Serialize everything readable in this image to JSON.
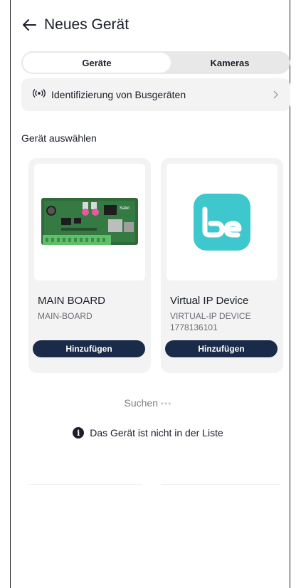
{
  "header": {
    "title": "Neues Gerät",
    "back_icon": "arrow-left-icon"
  },
  "tabs": [
    {
      "label": "Geräte",
      "active": true
    },
    {
      "label": "Kameras",
      "active": false
    }
  ],
  "bus_identification": {
    "label": "Identifizierung von Busgeräten",
    "icon": "broadcast-icon"
  },
  "section_title": "Gerät auswählen",
  "devices": [
    {
      "name": "MAIN BOARD",
      "model": "MAIN-BOARD",
      "serial": "",
      "button": "Hinzufügen",
      "image": "circuit-board"
    },
    {
      "name": "Virtual IP Device",
      "model": "VIRTUAL-IP DEVICE",
      "serial": "1778136101",
      "button": "Hinzufügen",
      "image": "be-logo"
    }
  ],
  "search": {
    "label": "Suchen",
    "dots": "•••"
  },
  "not_in_list": {
    "label": "Das Gerät ist nicht in der Liste",
    "icon": "info-icon"
  },
  "colors": {
    "primary_button": "#1a2b4a",
    "be_logo": "#3ec7cc",
    "card_bg": "#f3f3f3",
    "segment_bg": "#e8e8e8"
  }
}
